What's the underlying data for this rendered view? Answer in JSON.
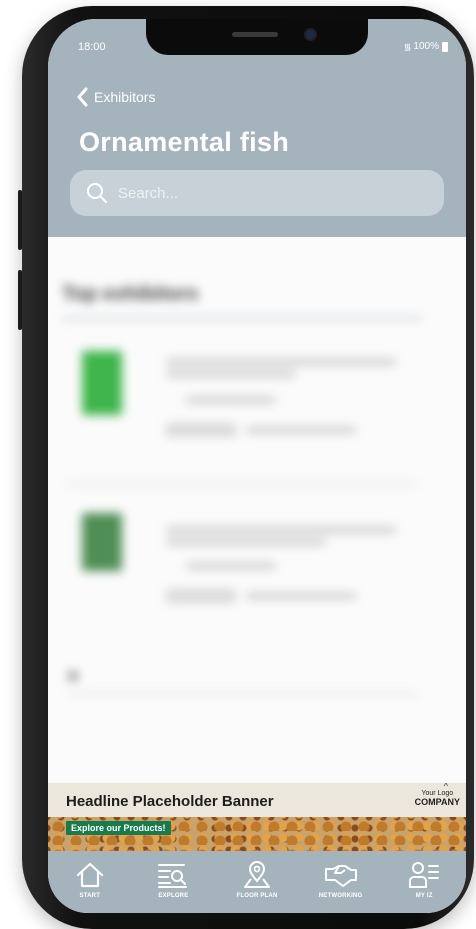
{
  "status_bar": {
    "time": "18:00",
    "battery": "100%"
  },
  "header": {
    "back_label": "Exhibitors",
    "title": "Ornamental fish"
  },
  "search": {
    "placeholder": "Search..."
  },
  "content": {
    "section_title": "Top exhibitors"
  },
  "banner": {
    "headline": "Headline Placeholder Banner",
    "cta": "Explore our Products!",
    "logo_top": "Your Logo",
    "logo_bottom": "COMPANY"
  },
  "tabs": [
    {
      "label": "START",
      "icon": "home-icon"
    },
    {
      "label": "EXPLORE",
      "icon": "explore-icon"
    },
    {
      "label": "FLOOR PLAN",
      "icon": "map-pin-icon"
    },
    {
      "label": "NETWORKING",
      "icon": "handshake-icon"
    },
    {
      "label": "MY IZ",
      "icon": "profile-menu-icon"
    }
  ],
  "colors": {
    "header_bg": "#a5b3bd",
    "search_bg": "#c8d1d8",
    "cta_green": "#197a4d",
    "thumb_green": "#3fb54b"
  }
}
